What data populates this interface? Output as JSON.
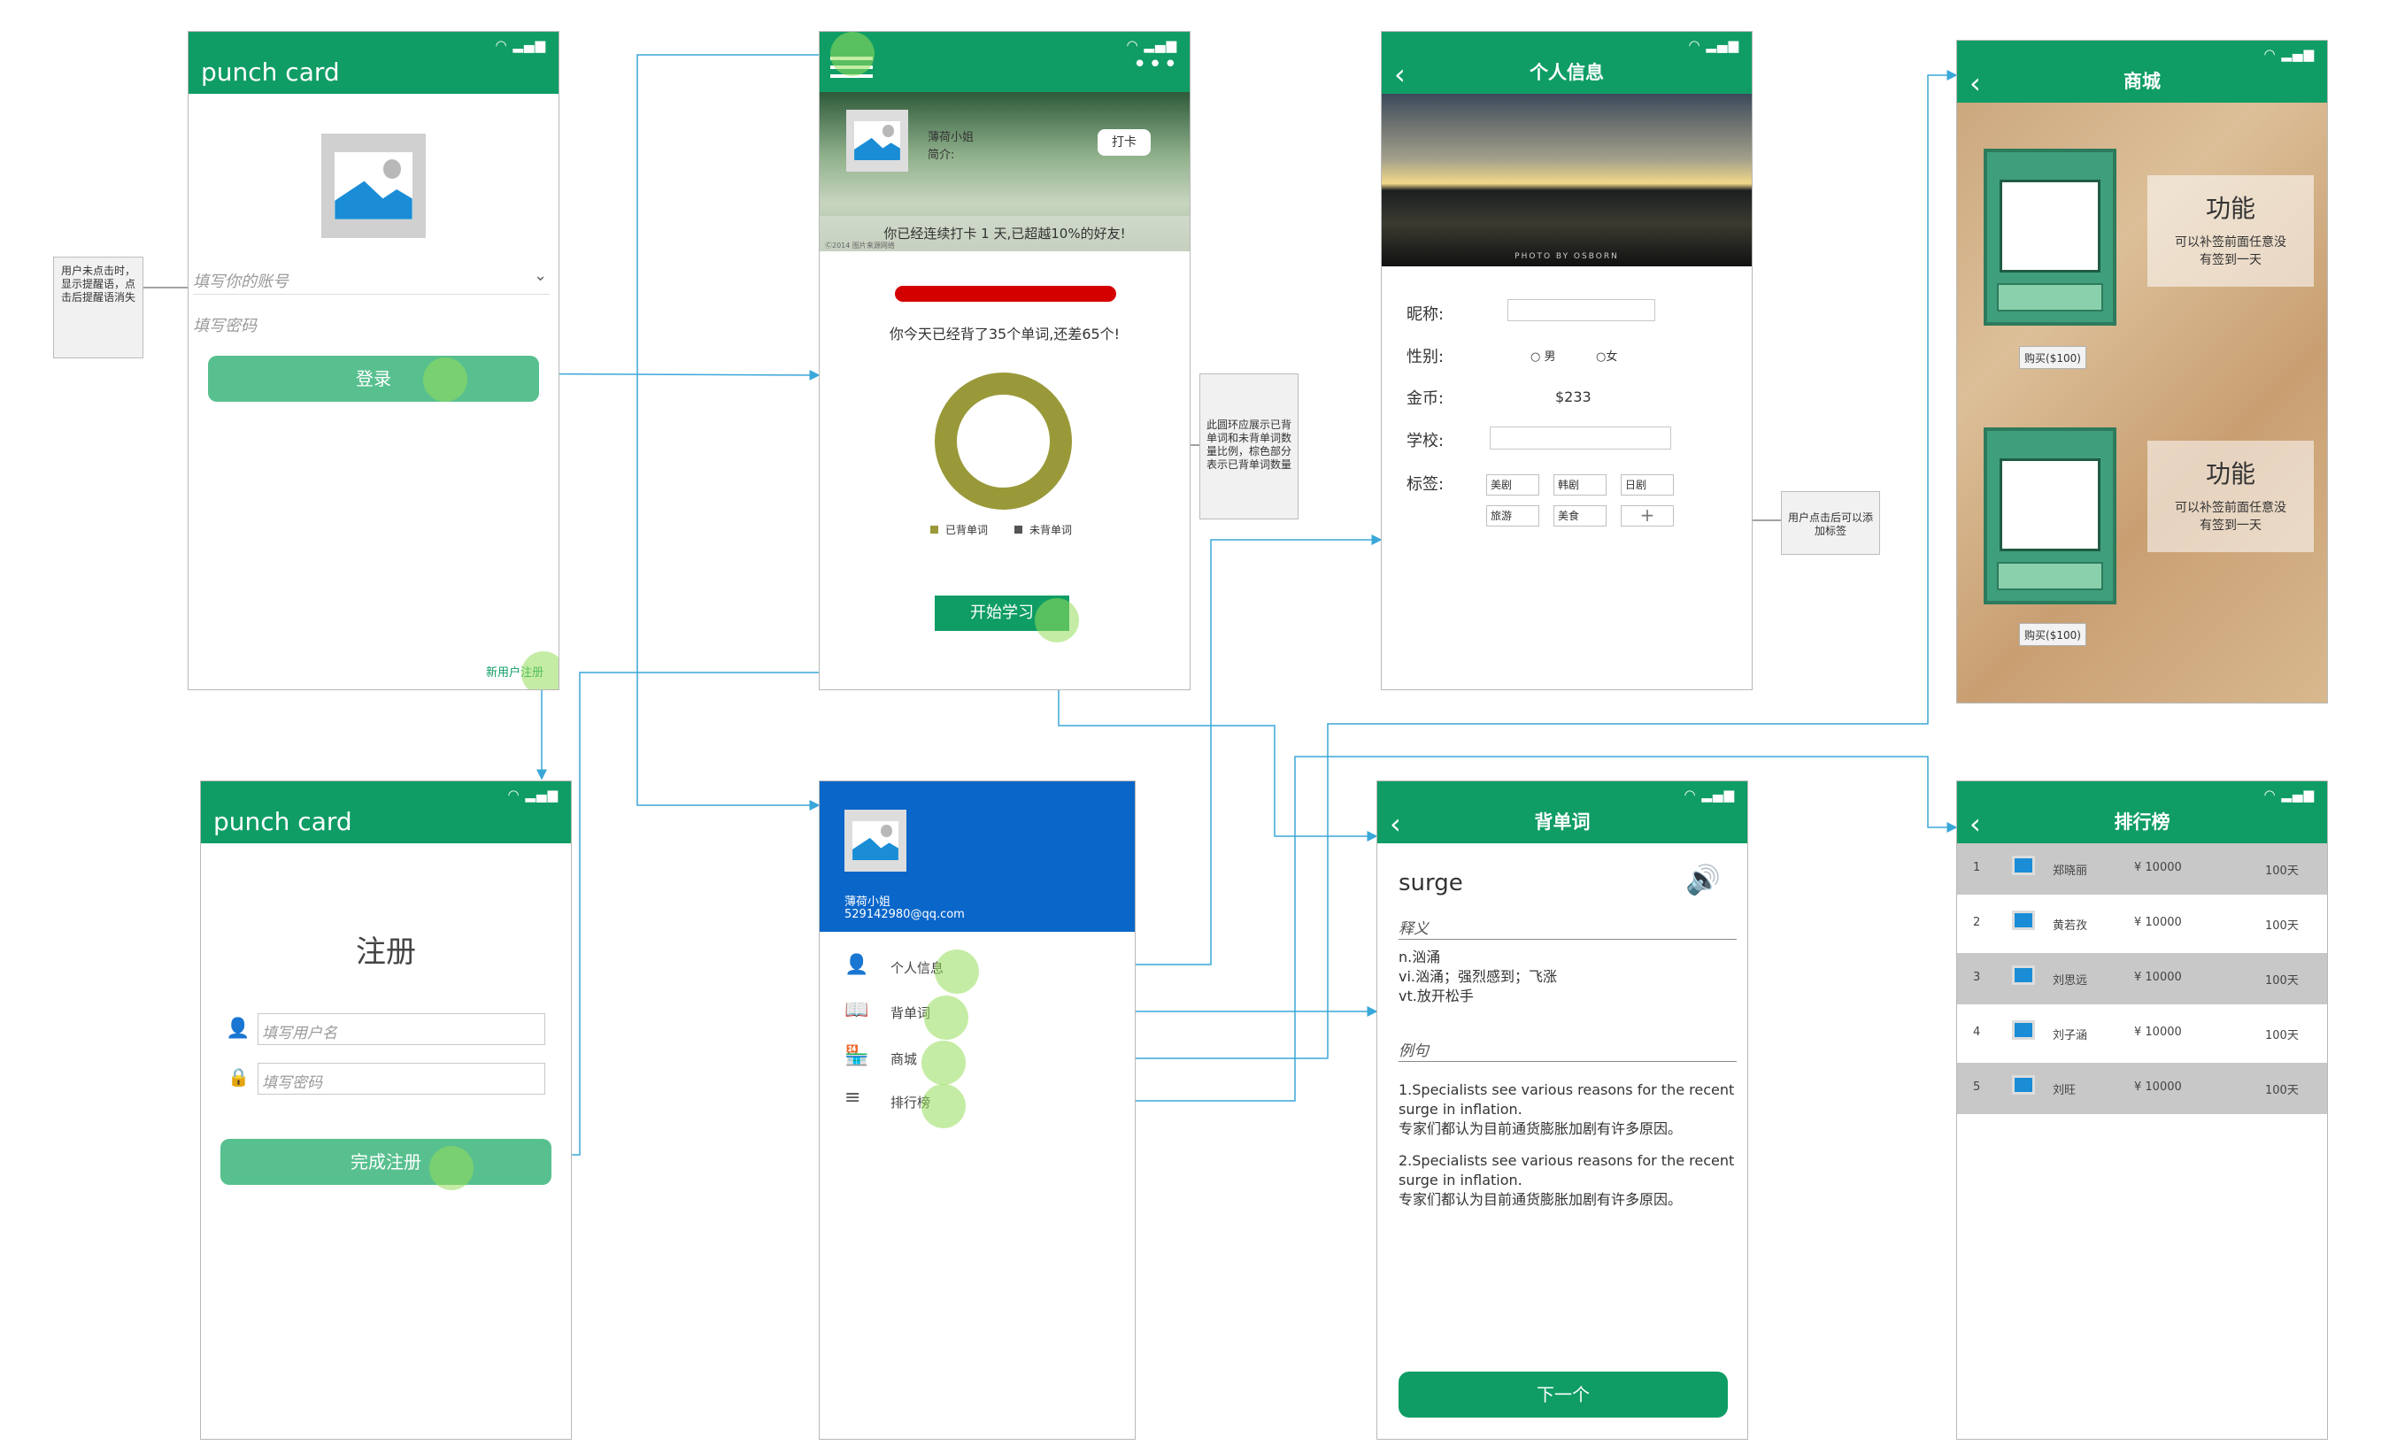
{
  "login": {
    "title": "punch card",
    "account_placeholder": "填写你的账号",
    "password_placeholder": "填写密码",
    "login_button": "登录",
    "register_link": "新用户注册"
  },
  "register": {
    "title": "punch card",
    "heading": "注册",
    "username_placeholder": "填写用户名",
    "password_placeholder": "填写密码",
    "submit_button": "完成注册"
  },
  "notes": {
    "login_hint": "用户未点击时，显示提醒语，点击后提醒语消失",
    "ring_hint": "此圆环应展示已背单词和未背单词数量比例，棕色部分表示已背单词数量",
    "tag_hint": "用户点击后可以添加标签"
  },
  "home": {
    "name": "薄荷小姐",
    "intro": "简介:",
    "punch_button": "打卡",
    "streak_text": "你已经连续打卡 1 天,已超越10%的好友!",
    "progress_text": "你今天已经背了35个单词,还差65个!",
    "legend_learned": "已背单词",
    "legend_unlearned": "未背单词",
    "start_button": "开始学习",
    "banner_caption": "Ⓒ2014 图片来源网络"
  },
  "drawer": {
    "name": "薄荷小姐",
    "email": "529142980@qq.com",
    "items": [
      "个人信息",
      "背单词",
      "商城",
      "排行榜"
    ]
  },
  "profile": {
    "title": "个人信息",
    "photo_caption": "PHOTO BY OSBORN",
    "nickname_label": "昵称:",
    "gender_label": "性别:",
    "male": "男",
    "female": "女",
    "coins_label": "金币:",
    "coins_value": "$233",
    "school_label": "学校:",
    "tags_label": "标签:",
    "tags": [
      "美剧",
      "韩剧",
      "日剧",
      "旅游",
      "美食"
    ],
    "add_tag": "+"
  },
  "words": {
    "title": "背单词",
    "word": "surge",
    "definition_heading": "释义",
    "definitions": [
      "n.汹涌",
      "vi.汹涌；强烈感到；飞涨",
      "vt.放开松手"
    ],
    "example_heading": "例句",
    "example1_en": "1.Specialists see various reasons for the recent surge in inflation.",
    "example1_zh": "专家们都认为目前通货膨胀加剧有许多原因。",
    "example2_en": "2.Specialists see various reasons for the recent surge in inflation.",
    "example2_zh": "专家们都认为目前通货膨胀加剧有许多原因。",
    "next_button": "下一个"
  },
  "shop": {
    "title": "商城",
    "feature_title": "功能",
    "feature_desc": "可以补签前面任意没有签到一天",
    "buy_label": "购买($100)"
  },
  "rank": {
    "title": "排行榜",
    "rows": [
      {
        "no": "1",
        "name": "郑晓丽",
        "coins": "¥ 10000",
        "days": "100天"
      },
      {
        "no": "2",
        "name": "黄若孜",
        "coins": "¥ 10000",
        "days": "100天"
      },
      {
        "no": "3",
        "name": "刘思远",
        "coins": "¥ 10000",
        "days": "100天"
      },
      {
        "no": "4",
        "name": "刘子涵",
        "coins": "¥ 10000",
        "days": "100天"
      },
      {
        "no": "5",
        "name": "刘旺",
        "coins": "¥ 10000",
        "days": "100天"
      }
    ]
  },
  "colors": {
    "primary_green": "#0f9d65",
    "button_green": "#58c08f",
    "drawer_blue": "#0a66c9",
    "ring_olive": "#99993a",
    "progress_red": "#d40000",
    "connector_cyan": "#3aa7d9",
    "highlight": "#a6e07a"
  }
}
